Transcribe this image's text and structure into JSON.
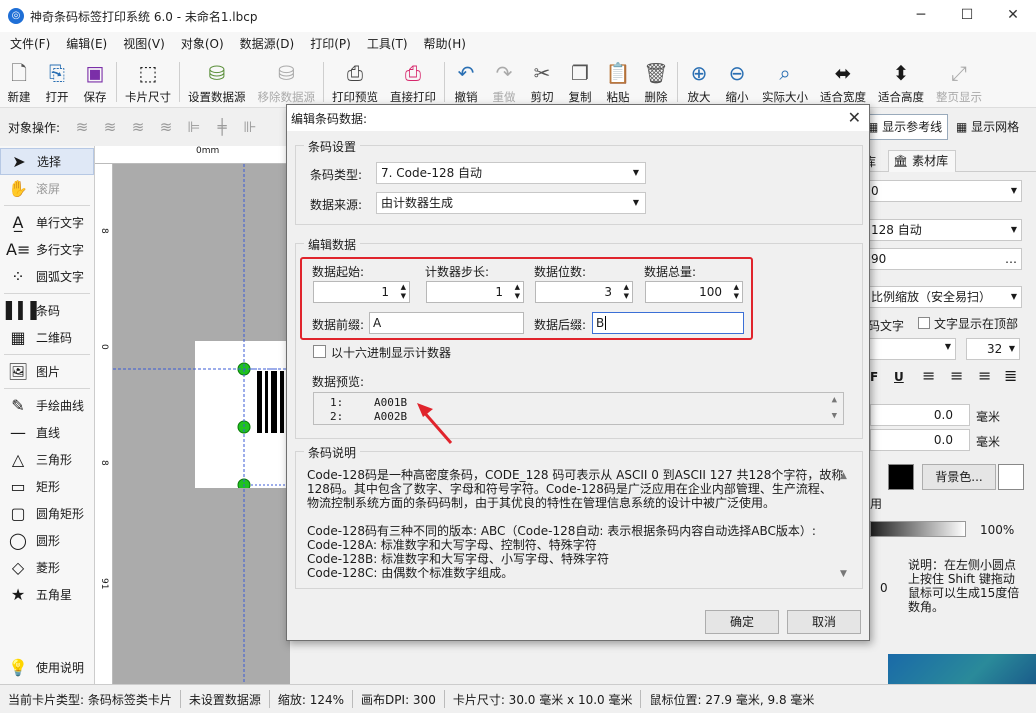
{
  "window": {
    "title": "神奇条码标签打印系统 6.0 - 未命名1.lbcp",
    "app_icon": "app-logo-icon"
  },
  "menu": [
    "文件(F)",
    "编辑(E)",
    "视图(V)",
    "对象(O)",
    "数据源(D)",
    "打印(P)",
    "工具(T)",
    "帮助(H)"
  ],
  "toolbar": [
    {
      "label": "新建",
      "icon": "new-file-icon"
    },
    {
      "label": "打开",
      "icon": "open-icon"
    },
    {
      "label": "保存",
      "icon": "save-icon"
    },
    {
      "label": "卡片尺寸",
      "icon": "card-size-icon"
    },
    {
      "label": "设置数据源",
      "icon": "datasource-icon"
    },
    {
      "label": "移除数据源",
      "icon": "remove-datasource-icon",
      "disabled": true
    },
    {
      "label": "打印预览",
      "icon": "print-preview-icon"
    },
    {
      "label": "直接打印",
      "icon": "print-icon"
    },
    {
      "label": "撤销",
      "icon": "undo-icon"
    },
    {
      "label": "重做",
      "icon": "redo-icon",
      "disabled": true
    },
    {
      "label": "剪切",
      "icon": "cut-icon"
    },
    {
      "label": "复制",
      "icon": "copy-icon"
    },
    {
      "label": "粘贴",
      "icon": "paste-icon"
    },
    {
      "label": "删除",
      "icon": "delete-icon"
    },
    {
      "label": "放大",
      "icon": "zoom-in-icon"
    },
    {
      "label": "缩小",
      "icon": "zoom-out-icon"
    },
    {
      "label": "实际大小",
      "icon": "actual-size-icon"
    },
    {
      "label": "适合宽度",
      "icon": "fit-width-icon"
    },
    {
      "label": "适合高度",
      "icon": "fit-height-icon"
    },
    {
      "label": "整页显示",
      "icon": "fit-page-icon",
      "disabled": true
    }
  ],
  "objbar": {
    "label": "对象操作:",
    "show_guides": "显示参考线",
    "show_grid": "显示网格"
  },
  "tools": [
    "选择",
    "滚屏",
    "单行文字",
    "多行文字",
    "圆弧文字",
    "条码",
    "二维码",
    "图片",
    "手绘曲线",
    "直线",
    "三角形",
    "矩形",
    "圆角矩形",
    "圆形",
    "菱形",
    "五角星",
    "使用说明"
  ],
  "ruler": {
    "top_zero": "0mm",
    "left_ticks": [
      "8",
      "0",
      "8",
      "91"
    ]
  },
  "dialog": {
    "title": "编辑条码数据:",
    "barcode_settings": {
      "group": "条码设置",
      "type_label": "条码类型:",
      "type_value": "7. Code-128 自动",
      "source_label": "数据来源:",
      "source_value": "由计数器生成"
    },
    "edit_data": {
      "group": "编辑数据",
      "start_label": "数据起始:",
      "start_value": "1",
      "step_label": "计数器步长:",
      "step_value": "1",
      "digits_label": "数据位数:",
      "digits_value": "3",
      "total_label": "数据总量:",
      "total_value": "100",
      "prefix_label": "数据前缀:",
      "prefix_value": "A",
      "suffix_label": "数据后缀:",
      "suffix_value": "B",
      "hex_label": "以十六进制显示计数器",
      "preview_label": "数据预览:",
      "preview_rows": [
        {
          "n": "1:",
          "v": "A001B"
        },
        {
          "n": "2:",
          "v": "A002B"
        }
      ]
    },
    "description": {
      "group": "条码说明",
      "p1": [
        "Code-128码是一种高密度条码，CODE_128 码可表示从 ASCII 0 到ASCII 127 共128个字符，故称",
        "128码。其中包含了数字、字母和符号字符。Code-128码是广泛应用在企业内部管理、生产流程、",
        "物流控制系统方面的条码码制，由于其优良的特性在管理信息系统的设计中被广泛使用。"
      ],
      "p2": [
        "Code-128码有三种不同的版本: ABC（Code-128自动: 表示根据条码内容自动选择ABC版本）:",
        "Code-128A: 标准数字和大写字母、控制符、特殊字符",
        "Code-128B: 标准数字和大写字母、小写字母、特殊字符",
        "Code-128C: 由偶数个标准数字组成。"
      ]
    },
    "ok_label": "确定",
    "cancel_label": "取消"
  },
  "right_panel": {
    "tab1": "库",
    "tab2": "素材库",
    "combo1": "0",
    "combo2": "128 自动",
    "field3": "90",
    "scale_mode": "比例缩放（安全易扫）",
    "text_bottom": "码文字",
    "text_top_label": "文字显示在顶部",
    "font_size": "32",
    "bold": "F",
    "underline": "U",
    "x_value": "0.0",
    "y_value": "0.0",
    "unit1": "毫米",
    "unit2": "毫米",
    "bg_button": "背景色...",
    "use": "用",
    "opacity": "100%",
    "zero": "0",
    "note": [
      "说明：在左侧小圆点",
      "上按住 Shift 键拖动",
      "鼠标可以生成15度倍",
      "数角。"
    ]
  },
  "status": {
    "card_type": "当前卡片类型: 条码标签类卡片",
    "datasource": "未设置数据源",
    "zoom": "缩放: 124%",
    "dpi": "画布DPI: 300",
    "card_size": "卡片尺寸: 30.0 毫米 x 10.0 毫米",
    "mouse": "鼠标位置: 27.9 毫米, 9.8 毫米"
  },
  "colors": {
    "accent": "#1f6fd6",
    "highlight_box": "#e0242c",
    "arrow": "#e0242c"
  }
}
